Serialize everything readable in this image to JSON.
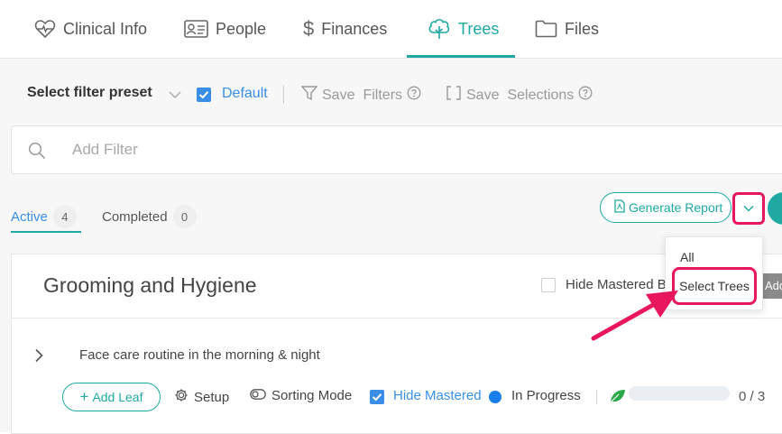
{
  "nav": {
    "tabs": [
      {
        "label": "Clinical Info",
        "icon": "heart-pulse-icon",
        "active": false
      },
      {
        "label": "People",
        "icon": "id-card-icon",
        "active": false
      },
      {
        "label": "Finances",
        "icon": "dollar-icon",
        "active": false
      },
      {
        "label": "Trees",
        "icon": "tree-icon",
        "active": true
      },
      {
        "label": "Files",
        "icon": "folder-icon",
        "active": false
      }
    ]
  },
  "filters": {
    "preset_label": "Select filter preset",
    "default_label": "Default",
    "default_checked": true,
    "save_label": "Save",
    "filters_label": "Filters",
    "save_selections_label": "Save",
    "selections_label": "Selections",
    "add_filter_placeholder": "Add Filter"
  },
  "status_tabs": [
    {
      "label": "Active",
      "count": "4",
      "active": true
    },
    {
      "label": "Completed",
      "count": "0",
      "active": false
    }
  ],
  "actions": {
    "generate_report": "Generate Report"
  },
  "dropdown_menu": {
    "items": [
      "All",
      "Select Trees"
    ],
    "highlighted": "Select Trees"
  },
  "card": {
    "title": "Grooming and Hygiene",
    "hide_mastered_label": "Hide Mastered B",
    "add_button_label": "Add",
    "rows": [
      {
        "title": "Face care routine in the morning & night",
        "add_leaf_label": "Add Leaf",
        "setup_label": "Setup",
        "sorting_mode_label": "Sorting Mode",
        "hide_mastered_label": "Hide Mastered",
        "hide_mastered_checked": true,
        "status_label": "In Progress",
        "progress_fraction": 0.0,
        "progress_count": "0 / 3"
      }
    ]
  },
  "colors": {
    "accent": "#1fa9a2",
    "link": "#3a8ee6",
    "highlight": "#e8175d"
  }
}
